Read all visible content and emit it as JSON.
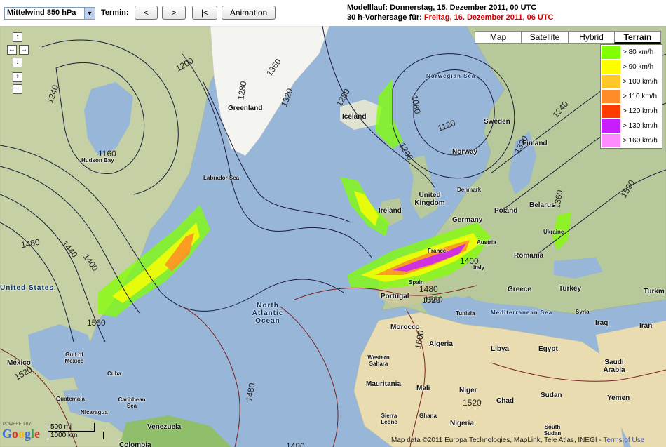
{
  "toolbar": {
    "level_select": "Mittelwind 850 hPa",
    "termin_label": "Termin:",
    "prev_label": "<",
    "next_label": ">",
    "first_label": "|<",
    "animation_label": "Animation"
  },
  "run_info": {
    "line1": "Modelllauf: Donnerstag, 15. Dezember 2011, 00 UTC",
    "line2_prefix": "30 h-Vorhersage für:",
    "line2_value": "Freitag, 16. Dezember 2011, 06 UTC"
  },
  "map_types": {
    "map": "Map",
    "satellite": "Satellite",
    "hybrid": "Hybrid",
    "terrain": "Terrain",
    "selected": "Terrain"
  },
  "legend": [
    {
      "label": "> 80 km/h",
      "color": "#80ff00"
    },
    {
      "label": "> 90 km/h",
      "color": "#ffff00"
    },
    {
      "label": "> 100 km/h",
      "color": "#ffc828"
    },
    {
      "label": "> 110 km/h",
      "color": "#ff8c28"
    },
    {
      "label": "> 120 km/h",
      "color": "#ff3c00"
    },
    {
      "label": "> 130 km/h",
      "color": "#c81eff"
    },
    {
      "label": "> 160 km/h",
      "color": "#ff8cff"
    }
  ],
  "navigation": {
    "up": "↑",
    "left": "←",
    "right": "→",
    "down": "↓",
    "zoom_in": "+",
    "zoom_out": "−"
  },
  "places": {
    "greenland": "Greenland",
    "iceland": "Iceland",
    "norwegian_sea": "Norwegian Sea",
    "sweden": "Sweden",
    "finland": "Finland",
    "norway": "Norway",
    "hudson_bay": "Hudson Bay",
    "labrador_sea": "Labrador Sea",
    "denmark": "Denmark",
    "united_kingdom": "United Kingdom",
    "ireland": "Ireland",
    "germany": "Germany",
    "poland": "Poland",
    "belarus": "Belarus",
    "ukraine": "Ukraine",
    "austria": "Austria",
    "france": "France",
    "romania": "Romania",
    "italy": "Italy",
    "greece": "Greece",
    "turkey": "Turkey",
    "portugal": "Portugal",
    "spain": "Spain",
    "north_atlantic_ocean": "North Atlantic Ocean",
    "united_states": "United States",
    "mexico": "México",
    "gulf_of_mexico": "Gulf of Mexico",
    "cuba": "Cuba",
    "guatemala": "Guatemala",
    "nicaragua": "Nicaragua",
    "caribbean_sea": "Caribbean Sea",
    "venezuela": "Venezuela",
    "colombia": "Colombia",
    "morocco": "Morocco",
    "algeria": "Algeria",
    "libya": "Libya",
    "egypt": "Egypt",
    "western_sahara": "Western Sahara",
    "mauritania": "Mauritania",
    "mali": "Mali",
    "niger": "Niger",
    "chad": "Chad",
    "sudan": "Sudan",
    "south_sudan": "South Sudan",
    "nigeria": "Nigeria",
    "ghana": "Ghana",
    "saudi_arabia": "Saudi Arabia",
    "iraq": "Iraq",
    "syria": "Syria",
    "iran": "Iran",
    "turkm": "Turkm",
    "yemen": "Yemen",
    "mediterranean_sea": "Mediterranean Sea",
    "tunisia": "Tunisia",
    "sierra_leone": "Sierra Leone"
  },
  "contour_labels": {
    "c1200": "1200",
    "c1240": "1240",
    "c1160": "1160",
    "c1280": "1280",
    "c1320": "1320",
    "c1360": "1360",
    "c1080": "1080",
    "c1120": "1120",
    "c1520": "1520",
    "c1480": "1480",
    "c1440": "1440",
    "c1400": "1400",
    "c1560": "1560",
    "c1600": "1600"
  },
  "scale": {
    "mi": "500 mi",
    "km": "1000 km"
  },
  "branding": {
    "powered": "POWERED BY",
    "google": "Google"
  },
  "attribution": {
    "text": "Map data ©2011 Europa Technologies, MapLink, Tele Atlas, INEGI -",
    "terms": "Terms of Use"
  }
}
